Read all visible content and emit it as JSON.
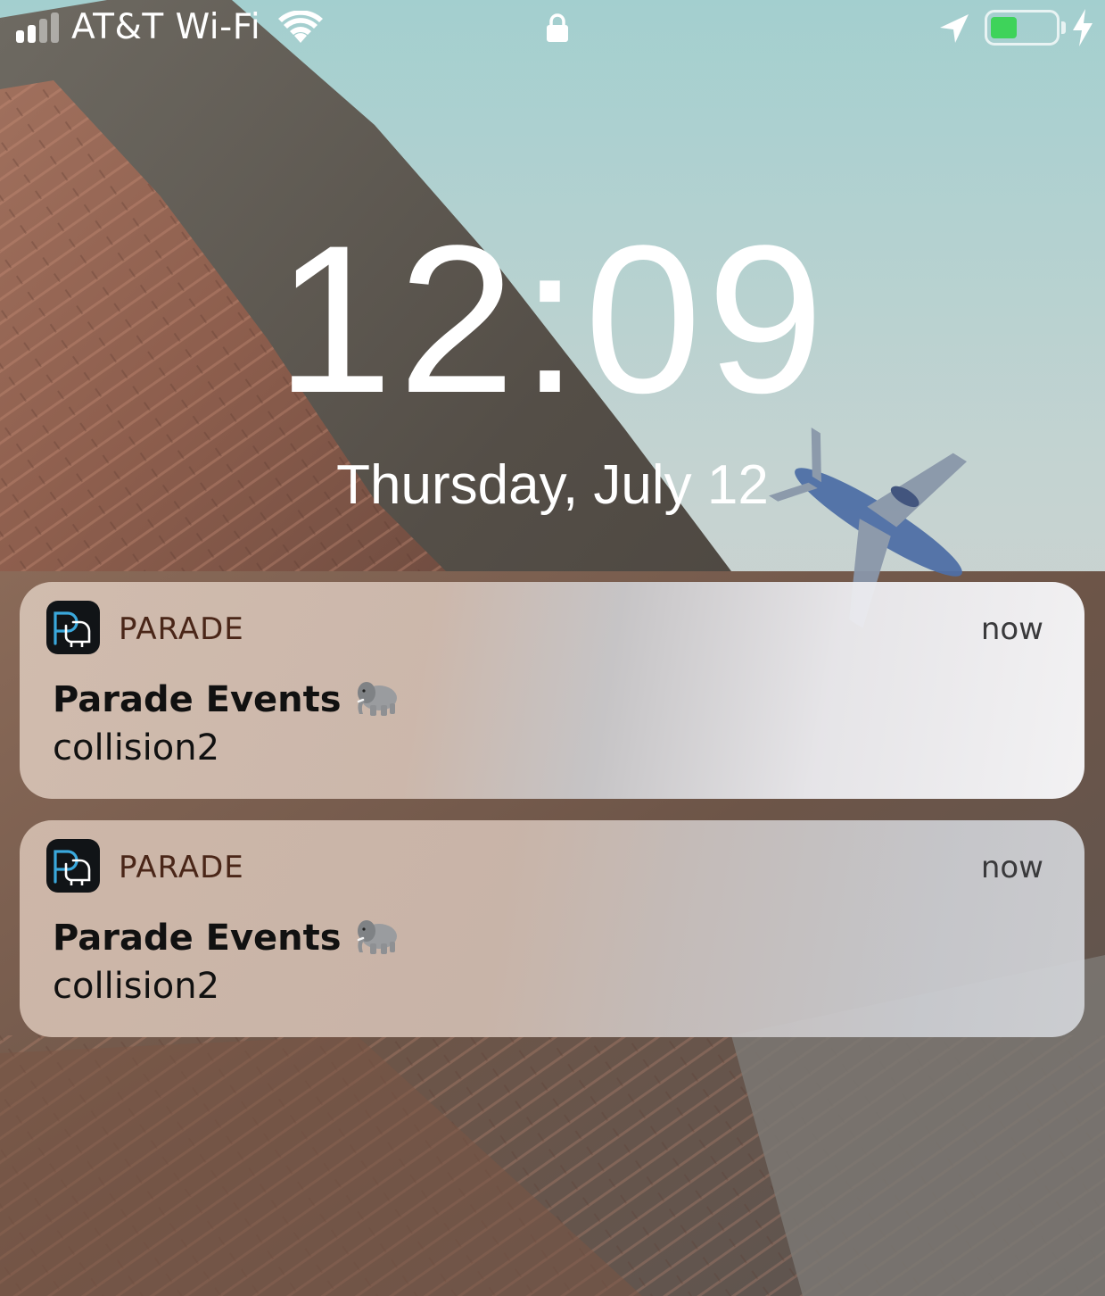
{
  "status_bar": {
    "carrier": "AT&T Wi-Fi",
    "signal_bars": 4,
    "signal_bars_active": 2,
    "battery_level": 0.4,
    "battery_color": "#3ed35a",
    "charging": true,
    "icons": [
      "signal-icon",
      "wifi-icon",
      "lock-icon",
      "location-arrow-icon",
      "battery-icon",
      "charging-bolt-icon"
    ]
  },
  "lock_screen": {
    "time": "12:09",
    "date": "Thursday, July 12"
  },
  "notifications": [
    {
      "app_name": "PARADE",
      "time": "now",
      "title": "Parade Events",
      "title_emoji": "elephant-icon",
      "body": "collision2"
    },
    {
      "app_name": "PARADE",
      "time": "now",
      "title": "Parade Events",
      "title_emoji": "elephant-icon",
      "body": "collision2"
    }
  ],
  "colors": {
    "app_name": "#4a2618",
    "app_icon_bg": "#111417",
    "app_icon_accent": "#3aa8dc"
  }
}
